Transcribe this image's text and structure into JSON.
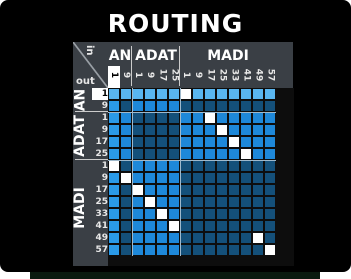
{
  "title": "ROUTING",
  "axis": {
    "in_label": "in",
    "out_label": "out"
  },
  "column_groups": [
    {
      "name": "AN",
      "labels": [
        "1",
        "9"
      ]
    },
    {
      "name": "ADAT",
      "labels": [
        "1",
        "9",
        "17",
        "25"
      ]
    },
    {
      "name": "MADI",
      "labels": [
        "1",
        "9",
        "17",
        "25",
        "33",
        "41",
        "49",
        "57"
      ]
    }
  ],
  "row_groups": [
    {
      "name": "AN",
      "labels": [
        "1",
        "9"
      ]
    },
    {
      "name": "ADAT",
      "labels": [
        "1",
        "9",
        "17",
        "25"
      ]
    },
    {
      "name": "MADI",
      "labels": [
        "1",
        "9",
        "17",
        "25",
        "33",
        "41",
        "49",
        "57"
      ]
    }
  ],
  "selected": {
    "row": 0,
    "col": 0
  },
  "colors": {
    "cell_light": "#1e88d9",
    "cell_dark": "#14507a",
    "cell_row_highlight": "#59b6f0",
    "cell_col_highlight": "#2a9ae8",
    "route_active": "#ffffff"
  },
  "routes": [
    [
      0,
      6
    ],
    [
      2,
      8
    ],
    [
      3,
      9
    ],
    [
      4,
      10
    ],
    [
      5,
      11
    ],
    [
      6,
      0
    ],
    [
      7,
      1
    ],
    [
      8,
      2
    ],
    [
      9,
      3
    ],
    [
      10,
      4
    ],
    [
      11,
      5
    ],
    [
      12,
      12
    ],
    [
      13,
      13
    ]
  ]
}
